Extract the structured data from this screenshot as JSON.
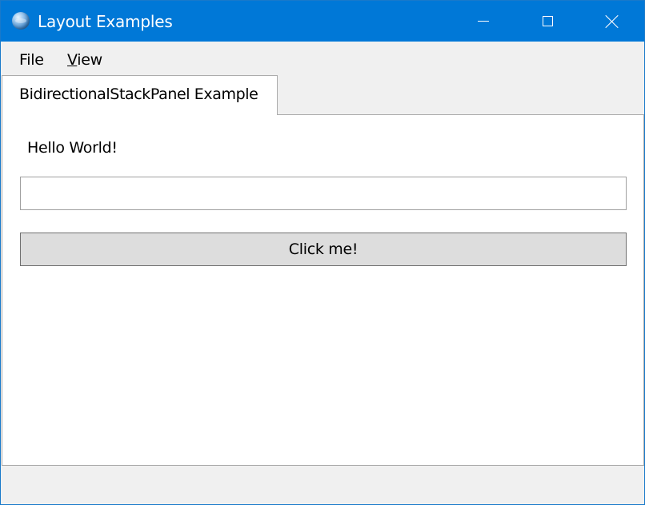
{
  "window": {
    "title": "Layout Examples",
    "accent_color": "#0078d7",
    "icon": "globe-icon"
  },
  "caption_buttons": {
    "minimize_icon": "minimize-icon",
    "maximize_icon": "maximize-icon",
    "close_icon": "close-icon"
  },
  "menu": {
    "items": [
      {
        "label": "File",
        "mnemonic": "",
        "rest": "File"
      },
      {
        "label": "View",
        "mnemonic": "V",
        "rest": "iew"
      }
    ]
  },
  "tabs": [
    {
      "label": "BidirectionalStackPanel Example",
      "selected": true
    }
  ],
  "content": {
    "greeting": "Hello World!",
    "input_value": "",
    "button_label": "Click me!"
  },
  "statusbar": {
    "text": ""
  }
}
